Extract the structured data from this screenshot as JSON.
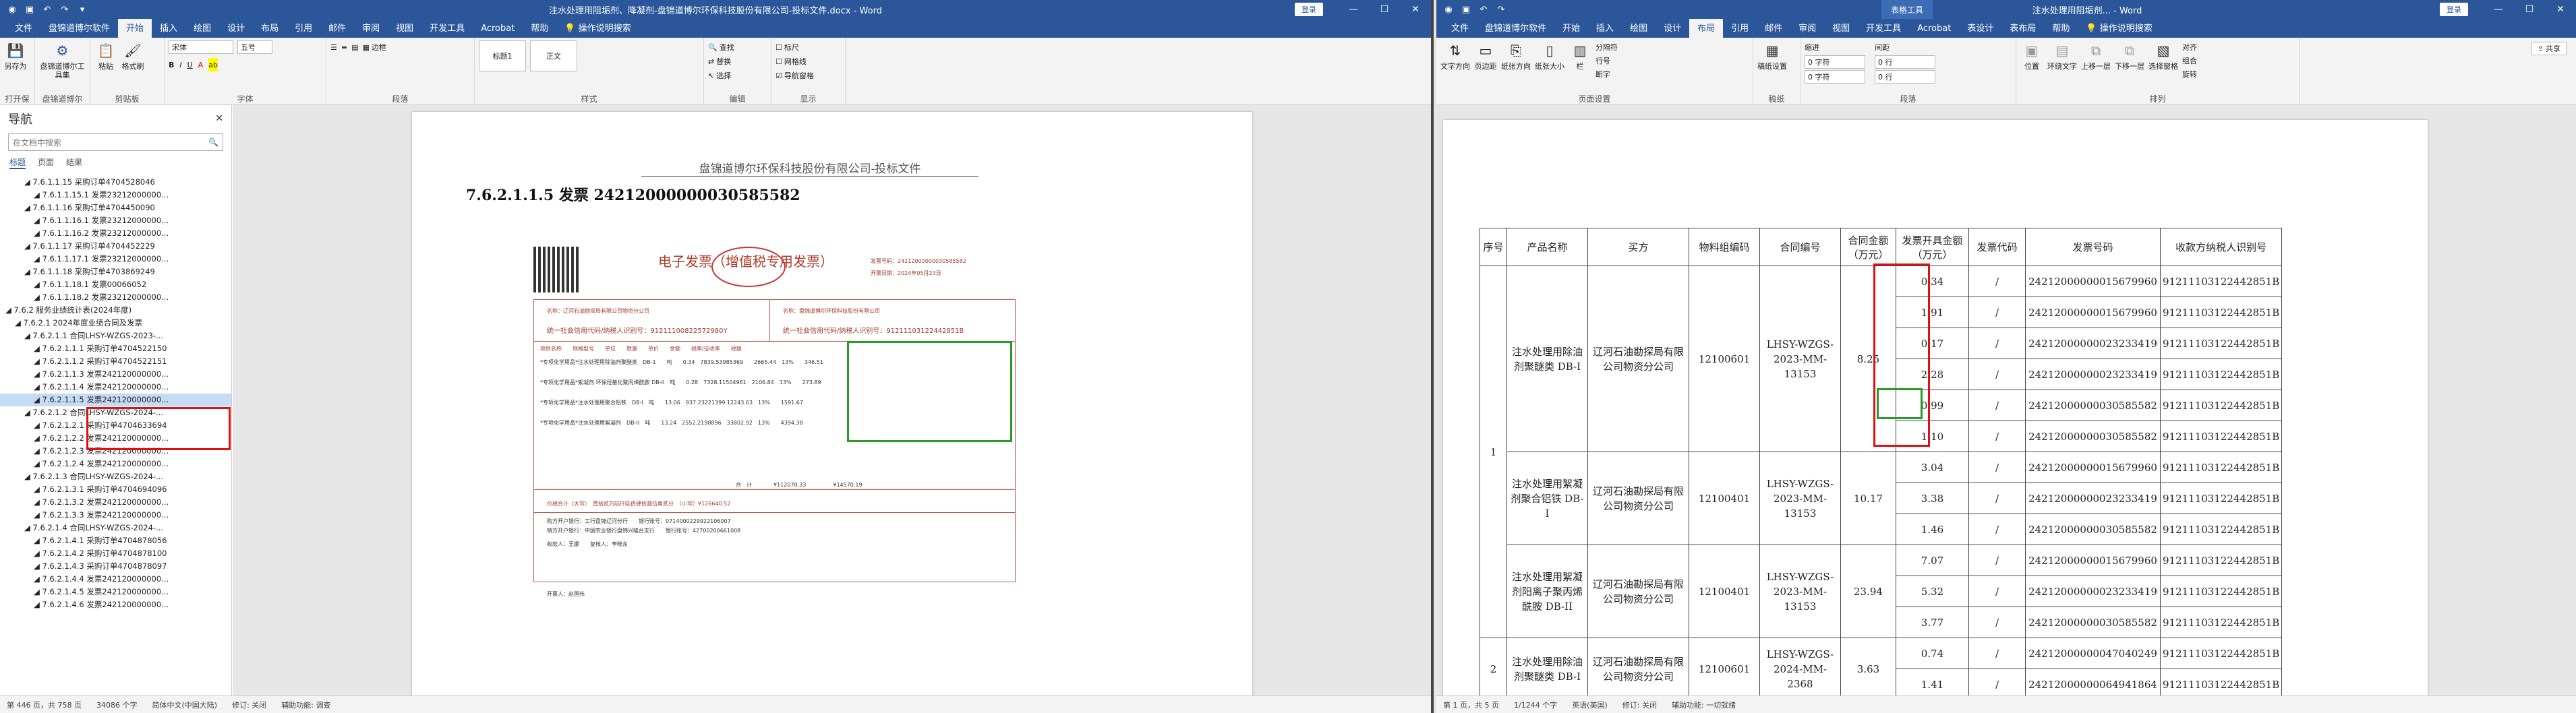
{
  "left_window": {
    "title": "注水处理用阻垢剂、降凝剂-盘锦道博尔环保科技股份有限公司-投标文件.docx - Word",
    "account_label": "登录",
    "tabs": [
      "文件",
      "盘锦道博尔软件",
      "开始",
      "插入",
      "绘图",
      "设计",
      "布局",
      "引用",
      "邮件",
      "审阅",
      "视图",
      "开发工具",
      "Acrobat",
      "帮助"
    ],
    "active_tab": "开始",
    "tell_me": "操作说明搜索",
    "ribbon": {
      "groups": [
        {
          "label": "打开保存",
          "buttons": [
            "另存为"
          ]
        },
        {
          "label": "盘锦道博尔软件",
          "buttons": [
            "盘锦道博尔工具集"
          ]
        },
        {
          "label": "剪贴板",
          "buttons": [
            "粘贴",
            "格式刷"
          ]
        },
        {
          "label": "字体",
          "buttons": [
            "宋体",
            "五号",
            "B",
            "I",
            "U"
          ]
        },
        {
          "label": "段落",
          "buttons": [
            "边框"
          ]
        },
        {
          "label": "样式",
          "buttons": [
            "标题1",
            "正文"
          ]
        },
        {
          "label": "编辑",
          "buttons": [
            "查找",
            "替换",
            "选择"
          ]
        },
        {
          "label": "显示",
          "buttons": [
            "标尺",
            "网格线",
            "导航窗格"
          ]
        }
      ],
      "font_name": "宋体",
      "font_size": "五号"
    },
    "nav": {
      "title": "导航",
      "search_placeholder": "在文档中搜索",
      "tabs": [
        "标题",
        "页面",
        "结果"
      ],
      "items": [
        "7.6.1.1.15 采购订单4704528046",
        "7.6.1.1.15.1 发票23212000000...",
        "7.6.1.1.16 采购订单4704450090",
        "7.6.1.1.16.1 发票23212000000...",
        "7.6.1.1.16.2 发票23212000000...",
        "7.6.1.1.17 采购订单4704452229",
        "7.6.1.1.17.1 发票23212000000...",
        "7.6.1.1.18 采购订单4703869249",
        "7.6.1.1.18.1 发票00066052",
        "7.6.1.1.18.2 发票23212000000...",
        "7.6.2 服务业绩统计表(2024年度)",
        "7.6.2.1 2024年度业绩合同及发票",
        "7.6.2.1.1 合同LHSY-WZGS-2023-...",
        "7.6.2.1.1.1 采购订单4704522150",
        "7.6.2.1.1.2 采购订单4704522151",
        "7.6.2.1.1.3 发票242120000000...",
        "7.6.2.1.1.4 发票242120000000...",
        "7.6.2.1.1.5 发票242120000000...",
        "7.6.2.1.2 合同LHSY-WZGS-2024-...",
        "7.6.2.1.2.1 采购订单4704633694",
        "7.6.2.1.2.2 发票242120000000...",
        "7.6.2.1.2.3 发票242120000000...",
        "7.6.2.1.2.4 发票242120000000...",
        "7.6.2.1.3 合同LHSY-WZGS-2024-...",
        "7.6.2.1.3.1 采购订单4704694096",
        "7.6.2.1.3.2 发票242120000000...",
        "7.6.2.1.3.3 发票242120000000...",
        "7.6.2.1.4 合同LHSY-WZGS-2024-...",
        "7.6.2.1.4.1 采购订单4704878056",
        "7.6.2.1.4.2 采购订单4704878100",
        "7.6.2.1.4.3 采购订单4704878097",
        "7.6.2.1.4.4 发票242120000000...",
        "7.6.2.1.4.5 发票242120000000...",
        "7.6.2.1.4.6 发票242120000000..."
      ]
    },
    "doc": {
      "header_text": "盘锦道博尔环保科技股份有限公司-投标文件",
      "heading": "7.6.2.1.1.5 发票 24212000000030585582",
      "invoice_title": "电子发票（增值税专用发票）",
      "invoice_number_label": "发票号码：24212000000030585582",
      "invoice_date_label": "开票日期：2024年05月23日",
      "buyer_name": "名称：辽河石油勘探局有限公司物资分公司",
      "seller_name": "名称：盘锦道博尔环保科技股份有限公司",
      "buyer_tax": "统一社会信用代码/纳税人识别号：91211100822572980Y",
      "seller_tax": "统一社会信用代码/纳税人识别号：91211103122442851B",
      "item_header": "项目名称　　规格型号　　单位　　数量　　单价　　金额　　税率/征收率　　税额",
      "items": [
        "*专项化学用品*注水处理用除油剂聚醚类　DB-1　　吨　　0.34　7839.53985369　　2665.44　13%　　346.51",
        "*专项化学用品*絮凝剂 环保羟基化聚丙烯酰胺 DB-II　吨　　0.28　7328.11504961　2106.84　13%　　273.89",
        "*专项化学用品*注水处理用聚合铝铁　DB-I　吨　　13.06　937.23221399   12243.63　13%　　1591.67",
        "*专项化学用品*注水处理用絮凝剂　DB-II　吨　　13.24　2552.2198896　33802.92　13%　　4394.38"
      ],
      "total_line": "合　计　　　　¥112070.33　　　　　¥14570.19",
      "total_tax_label": "价税合计（大写）　壹拾贰万陆仟陆佰肆拾圆伍角贰分　（小写）¥126640.52",
      "remarks_1": "购方开户银行：工行盘锦辽河分行　　银行账号：0714000229922106007",
      "remarks_2": "销方开户银行：中国农业银行盘锦兴隆台支行　　银行账号：42700200661008",
      "remarks_3": "收款人：王娜　　复核人：李晓东",
      "issuer": "开票人：赵国伟"
    },
    "status": {
      "page": "第 446 页，共 758 页",
      "words": "34086 个字",
      "language": "简体中文(中国大陆)",
      "track": "修订: 关闭",
      "accessibility": "辅助功能: 调查"
    }
  },
  "right_window": {
    "title": "注水处理用阻垢剂... - Word",
    "context_tab": "表格工具",
    "account_label": "登录",
    "tabs": [
      "文件",
      "盘锦道博尔软件",
      "开始",
      "插入",
      "绘图",
      "设计",
      "布局",
      "引用",
      "邮件",
      "审阅",
      "视图",
      "开发工具",
      "Acrobat",
      "表设计",
      "表布局",
      "帮助"
    ],
    "active_tab": "布局",
    "tell_me": "操作说明搜索",
    "share_label": "共享",
    "ribbon": {
      "groups": [
        {
          "label": "页面设置",
          "buttons": [
            "文字方向",
            "页边距",
            "纸张方向",
            "纸张大小",
            "栏",
            "分隔符",
            "行号",
            "断字"
          ]
        },
        {
          "label": "稿纸",
          "buttons": [
            "稿纸设置"
          ]
        },
        {
          "label": "段落",
          "buttons": [
            "缩进",
            "间距"
          ]
        },
        {
          "label": "排列",
          "buttons": [
            "位置",
            "环绕文字",
            "上移一层",
            "下移一层",
            "选择窗格",
            "对齐",
            "组合",
            "旋转"
          ]
        }
      ],
      "indent_left": "0 字符",
      "indent_right": "0 字符",
      "spacing_before": "0 行",
      "spacing_after": "0 行"
    },
    "table": {
      "headers": [
        "序号",
        "产品名称",
        "买方",
        "物料组编码",
        "合同编号",
        "合同金额（万元）",
        "发票开具金额（万元）",
        "发票代码",
        "发票号码",
        "收款方纳税人识别号"
      ],
      "seq": "1",
      "seq2": "2",
      "products": [
        {
          "name": "注水处理用除油剂聚醚类 DB-I",
          "buyer": "辽河石油勘探局有限公司物资分公司",
          "code": "12100601",
          "contract": "LHSY-WZGS-2023-MM-13153",
          "amount": "8.25"
        },
        {
          "name": "注水处理用絮凝剂聚合铝铁 DB-I",
          "buyer": "辽河石油勘探局有限公司物资分公司",
          "code": "12100401",
          "contract": "LHSY-WZGS-2023-MM-13153",
          "amount": "10.17"
        },
        {
          "name": "注水处理用絮凝剂阳离子聚丙烯酰胺 DB-II",
          "buyer": "辽河石油勘探局有限公司物资分公司",
          "code": "12100401",
          "contract": "LHSY-WZGS-2023-MM-13153",
          "amount": "23.94"
        },
        {
          "name": "注水处理用除油剂聚醚类 DB-I",
          "buyer": "辽河石油勘探局有限公司物资分公司",
          "code": "12100601",
          "contract": "LHSY-WZGS-2024-MM-2368",
          "amount": "3.63"
        }
      ],
      "rows": [
        {
          "inv": "0.34",
          "code": "/",
          "num": "24212000000015679960",
          "tax": "91211103122442851B"
        },
        {
          "inv": "1.91",
          "code": "/",
          "num": "24212000000015679960",
          "tax": "91211103122442851B"
        },
        {
          "inv": "0.17",
          "code": "/",
          "num": "24212000000023233419",
          "tax": "91211103122442851B"
        },
        {
          "inv": "2.28",
          "code": "/",
          "num": "24212000000023233419",
          "tax": "91211103122442851B"
        },
        {
          "inv": "0.99",
          "code": "/",
          "num": "24212000000030585582",
          "tax": "91211103122442851B"
        },
        {
          "inv": "1.10",
          "code": "/",
          "num": "24212000000030585582",
          "tax": "91211103122442851B"
        },
        {
          "inv": "3.04",
          "code": "/",
          "num": "24212000000015679960",
          "tax": "91211103122442851B"
        },
        {
          "inv": "3.38",
          "code": "/",
          "num": "24212000000023233419",
          "tax": "91211103122442851B"
        },
        {
          "inv": "1.46",
          "code": "/",
          "num": "24212000000030585582",
          "tax": "91211103122442851B"
        },
        {
          "inv": "7.07",
          "code": "/",
          "num": "24212000000015679960",
          "tax": "91211103122442851B"
        },
        {
          "inv": "5.32",
          "code": "/",
          "num": "24212000000023233419",
          "tax": "91211103122442851B"
        },
        {
          "inv": "3.77",
          "code": "/",
          "num": "24212000000030585582",
          "tax": "91211103122442851B"
        },
        {
          "inv": "0.74",
          "code": "/",
          "num": "24212000000047040249",
          "tax": "91211103122442851B"
        },
        {
          "inv": "1.41",
          "code": "/",
          "num": "24212000000064941864",
          "tax": "91211103122442851B"
        }
      ]
    },
    "status": {
      "page": "第 1 页，共 5 页",
      "words": "1/1244 个字",
      "language": "英语(美国)",
      "track": "修订: 关闭",
      "accessibility": "辅助功能: 一切就绪"
    }
  },
  "colors": {
    "word_blue": "#2b579a",
    "highlight_red": "#dd1111",
    "highlight_green": "#2a9a2a",
    "invoice_red": "#a03a2a"
  }
}
